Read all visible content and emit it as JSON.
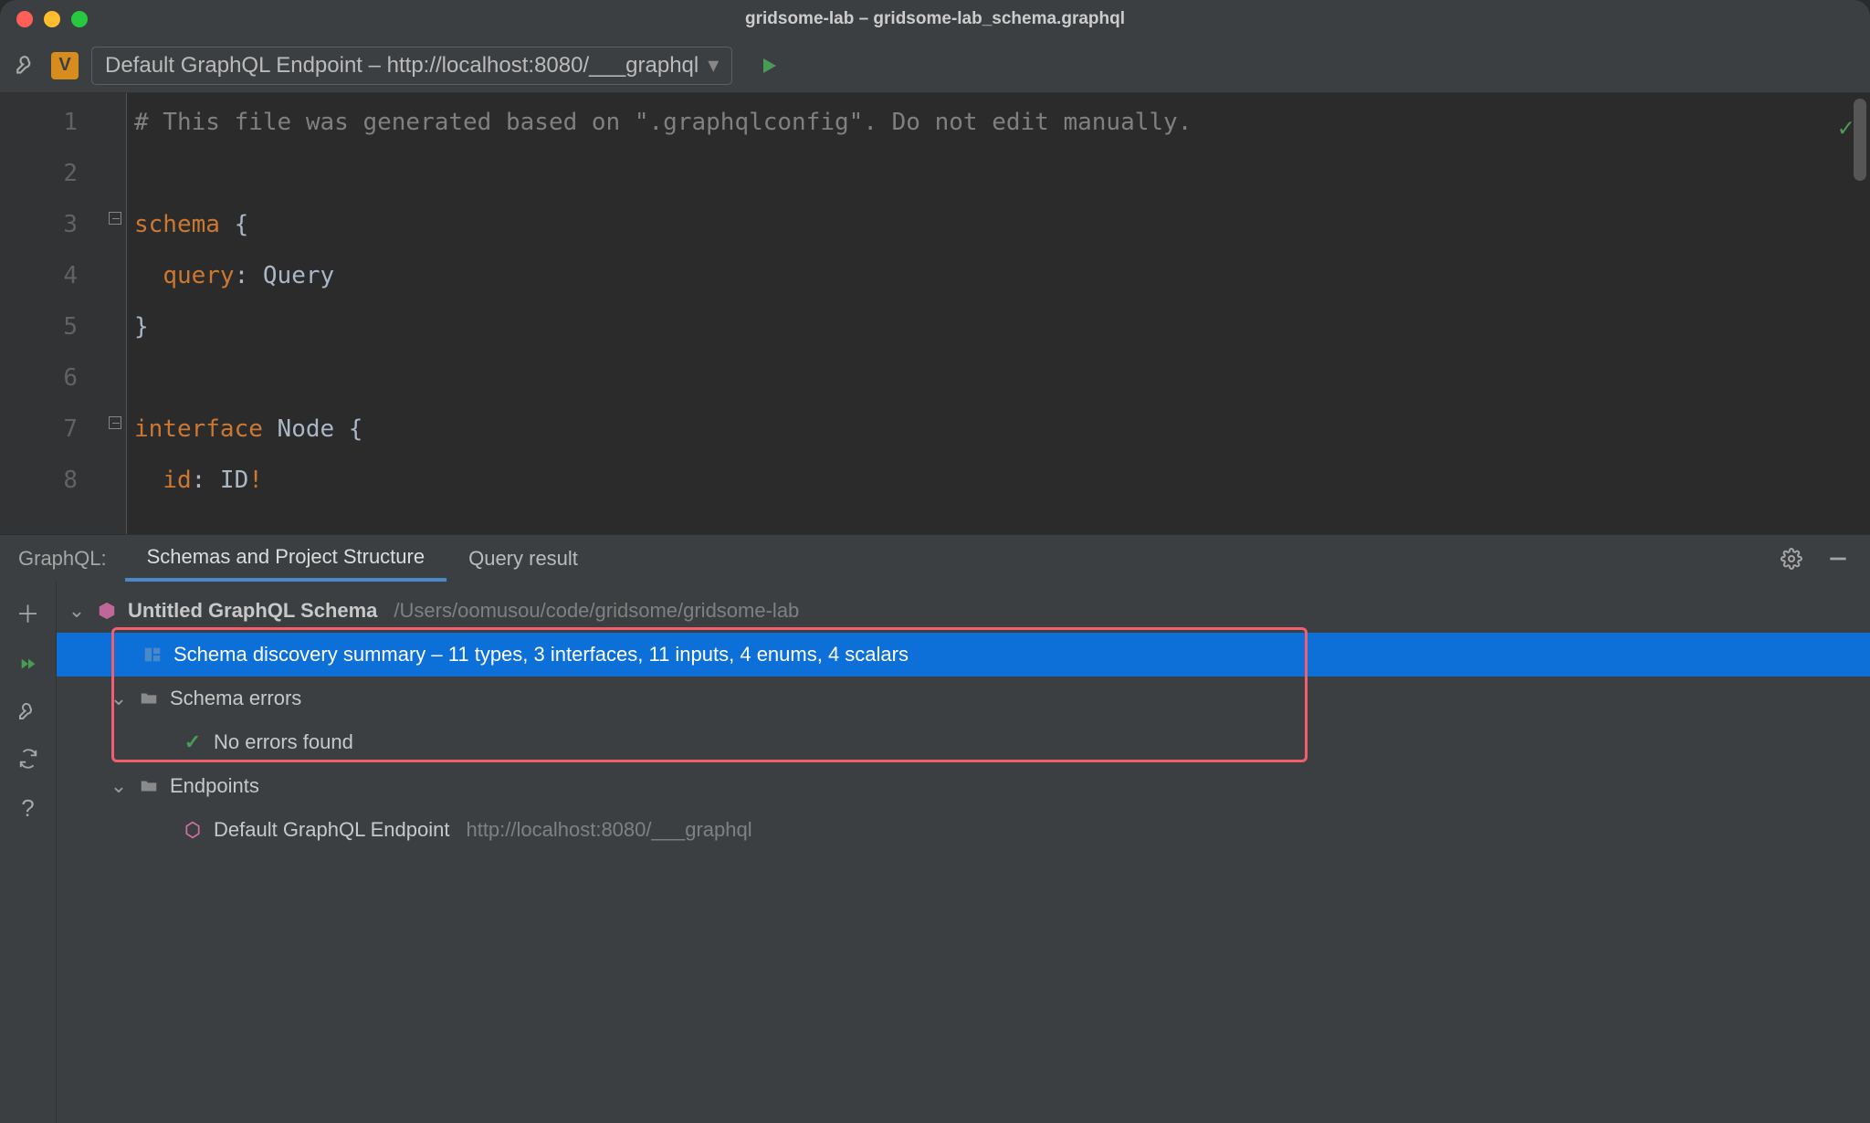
{
  "window": {
    "title": "gridsome-lab – gridsome-lab_schema.graphql"
  },
  "toolbar": {
    "endpoint_label": "Default GraphQL Endpoint – http://localhost:8080/___graphql"
  },
  "editor": {
    "gutter": [
      "1",
      "2",
      "3",
      "4",
      "5",
      "6",
      "7",
      "8"
    ],
    "lines": [
      {
        "segments": [
          {
            "t": "# This file was generated based on \".graphqlconfig\". Do not edit manually.",
            "c": "comment"
          }
        ]
      },
      {
        "segments": [
          {
            "t": "",
            "c": ""
          }
        ]
      },
      {
        "segments": [
          {
            "t": "schema",
            "c": "kw"
          },
          {
            "t": " {",
            "c": ""
          }
        ]
      },
      {
        "segments": [
          {
            "t": "  ",
            "c": ""
          },
          {
            "t": "query",
            "c": "var"
          },
          {
            "t": ": Query",
            "c": "type"
          }
        ]
      },
      {
        "segments": [
          {
            "t": "}",
            "c": ""
          }
        ]
      },
      {
        "segments": [
          {
            "t": "",
            "c": ""
          }
        ]
      },
      {
        "segments": [
          {
            "t": "interface",
            "c": "kw"
          },
          {
            "t": " Node {",
            "c": ""
          }
        ]
      },
      {
        "segments": [
          {
            "t": "  ",
            "c": ""
          },
          {
            "t": "id",
            "c": "var"
          },
          {
            "t": ": ID",
            "c": "type"
          },
          {
            "t": "!",
            "c": "excl"
          }
        ]
      }
    ]
  },
  "panel": {
    "title": "GraphQL:",
    "tabs": {
      "schemas": "Schemas and Project Structure",
      "query": "Query result"
    },
    "root": {
      "label": "Untitled GraphQL Schema",
      "path": "/Users/oomusou/code/gridsome/gridsome-lab"
    },
    "summary": "Schema discovery summary  – 11 types, 3 interfaces, 11 inputs, 4 enums, 4 scalars",
    "errors": {
      "label": "Schema errors",
      "msg": "No errors found"
    },
    "endpoints": {
      "label": "Endpoints",
      "items": [
        {
          "name": "Default GraphQL Endpoint",
          "url": "http://localhost:8080/___graphql"
        }
      ]
    }
  }
}
